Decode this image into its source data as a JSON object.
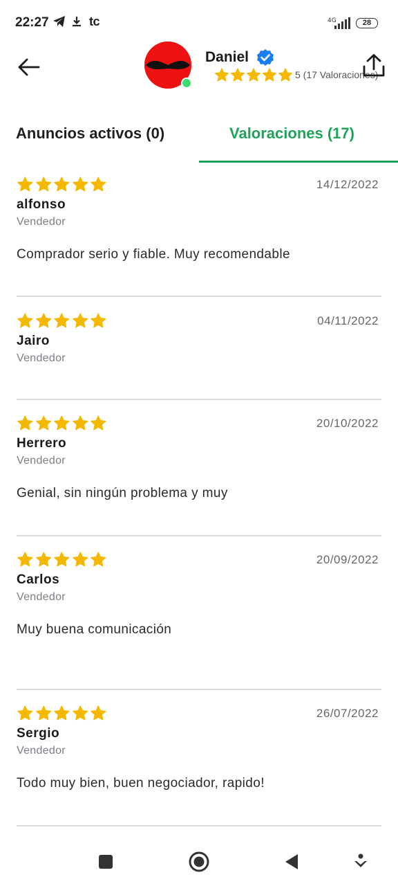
{
  "status_bar": {
    "time": "22:27",
    "network": "4G",
    "battery": "28",
    "icons": [
      "telegram-icon",
      "download-icon",
      "tc-app-icon",
      "signal-icon",
      "battery-icon"
    ],
    "tc_label": "tc"
  },
  "header": {
    "name": "Daniel",
    "rating_text": "5 (17 Valoraciones)",
    "rating_stars": 5,
    "verified": true
  },
  "tabs": [
    {
      "label": "Anuncios activos (0)",
      "active": false
    },
    {
      "label": "Valoraciones (17)",
      "active": true
    }
  ],
  "reviews": [
    {
      "stars": 5,
      "date": "14/12/2022",
      "name": "alfonso",
      "role": "Vendedor",
      "comment": "Comprador serio y fiable. Muy recomendable"
    },
    {
      "stars": 5,
      "date": "04/11/2022",
      "name": "Jairo",
      "role": "Vendedor",
      "comment": ""
    },
    {
      "stars": 5,
      "date": "20/10/2022",
      "name": "Herrero",
      "role": "Vendedor",
      "comment": "Genial, sin ningún problema y muy"
    },
    {
      "stars": 5,
      "date": "20/09/2022",
      "name": "Carlos",
      "role": "Vendedor",
      "comment": "Muy buena comunicación"
    },
    {
      "stars": 5,
      "date": "26/07/2022",
      "name": "Sergio",
      "role": "Vendedor",
      "comment": "Todo muy bien, buen negociador, rapido!"
    }
  ],
  "colors": {
    "accent": "#1fa35a",
    "star": "#f5b800",
    "avatar": "#ee1111",
    "verified": "#1a7ef0",
    "online": "#3ddc6e"
  }
}
